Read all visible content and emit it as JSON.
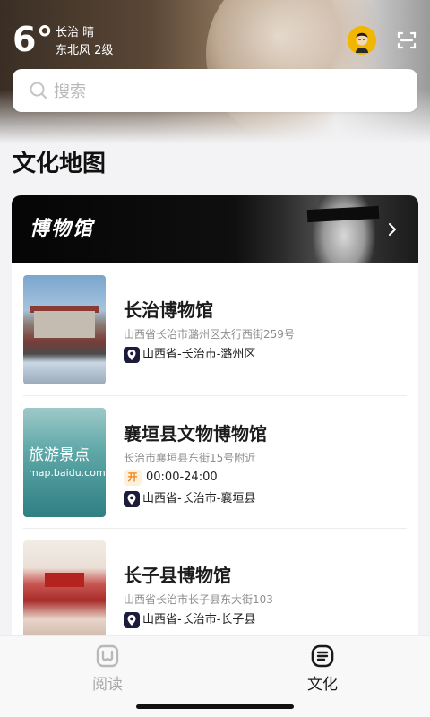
{
  "header": {
    "temperature": "6°",
    "city_weather": "长治 晴",
    "wind": "东北风 2级",
    "avatar_icon": "avatar-icon",
    "scan_icon": "scan-icon"
  },
  "search": {
    "placeholder": "搜索",
    "icon": "search-icon"
  },
  "section": {
    "title": "文化地图"
  },
  "banner": {
    "title": "博物馆",
    "chevron_icon": "chevron-right-icon"
  },
  "museums": [
    {
      "name": "长治博物馆",
      "address": "山西省长治市潞州区太行西街259号",
      "region": "山西省-长治市-潞州区"
    },
    {
      "name": "襄垣县文物博物馆",
      "address": "长治市襄垣县东街15号附近",
      "open_badge": "开",
      "hours": "00:00-24:00",
      "region": "山西省-长治市-襄垣县",
      "thumb_text_1": "旅游景点",
      "thumb_text_2": "map.baidu.com"
    },
    {
      "name": "长子县博物馆",
      "address": "山西省长治市长子县东大街103",
      "region": "山西省-长治市-长子县"
    }
  ],
  "tabs": [
    {
      "label": "阅读",
      "icon": "read-icon",
      "active": false
    },
    {
      "label": "文化",
      "icon": "culture-icon",
      "active": true
    }
  ],
  "colors": {
    "background": "#f3f3f5",
    "banner": "#0f0f0f",
    "location_badge": "#1b1b3a",
    "open_badge_text": "#e8861c",
    "avatar": "#f2b600"
  }
}
